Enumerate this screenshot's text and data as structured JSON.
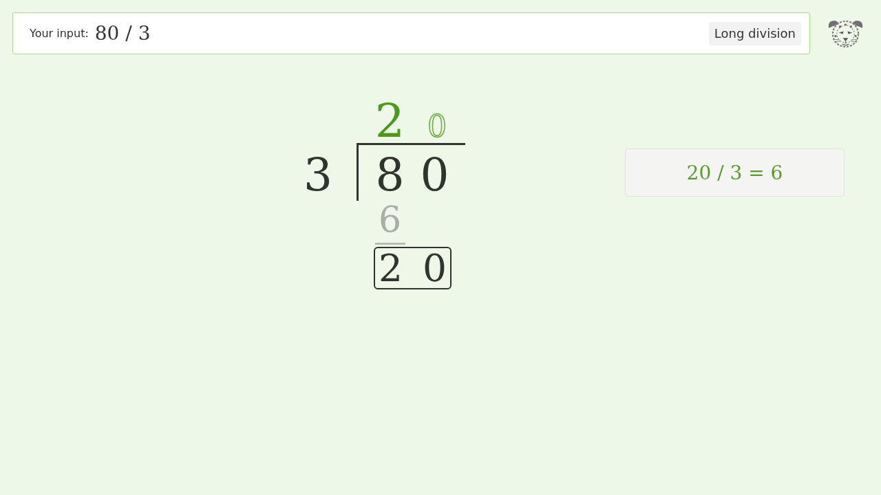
{
  "input_bar": {
    "label": "Your input:",
    "value": "80 / 3",
    "mode_button": "Long division"
  },
  "division": {
    "divisor": "3",
    "dividend": [
      "8",
      "0"
    ],
    "quotient": [
      {
        "digit": "2",
        "kind": "written"
      },
      {
        "digit": "0",
        "kind": "pending"
      }
    ],
    "steps": [
      {
        "kind": "product",
        "digits": [
          "6"
        ]
      },
      {
        "kind": "current",
        "digits": [
          "2",
          "0"
        ]
      }
    ]
  },
  "hint": {
    "text": "20 / 3 = 6"
  }
}
